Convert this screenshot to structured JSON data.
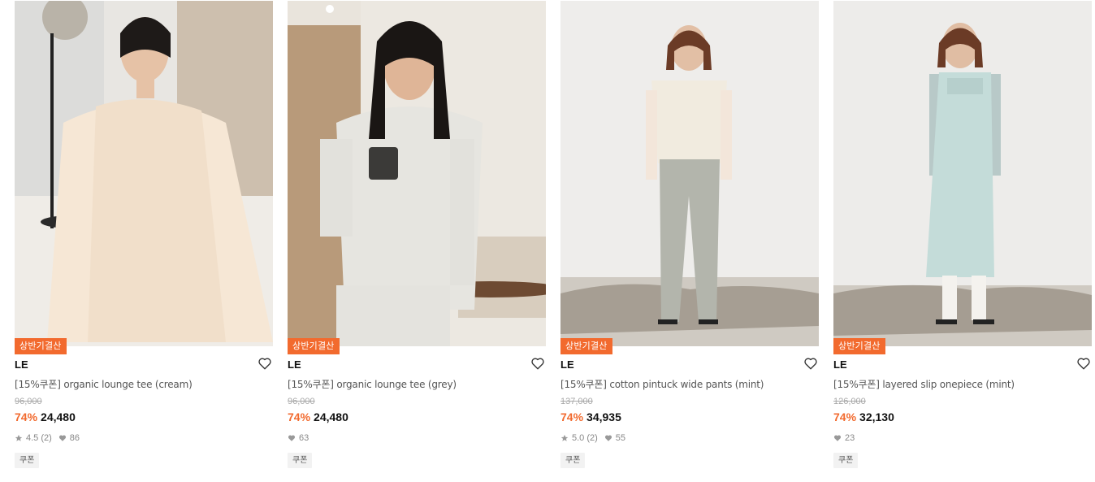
{
  "products": [
    {
      "promo_badge": "상반기결산",
      "brand": "LE",
      "title": "[15%쿠폰] organic lounge tee (cream)",
      "original_price": "96,000",
      "discount": "74%",
      "sale_price": "24,480",
      "rating": "4.5 (2)",
      "likes": "86",
      "coupon_label": "쿠폰",
      "image": "model in cream long-sleeve lounge tee sitting on sofa"
    },
    {
      "promo_badge": "상반기결산",
      "brand": "LE",
      "title": "[15%쿠폰] organic lounge tee (grey)",
      "original_price": "96,000",
      "discount": "74%",
      "sale_price": "24,480",
      "rating": "",
      "likes": "63",
      "coupon_label": "쿠폰",
      "image": "model in grey lounge tee holding mug"
    },
    {
      "promo_badge": "상반기결산",
      "brand": "LE",
      "title": "[15%쿠폰] cotton pintuck wide pants (mint)",
      "original_price": "137,000",
      "discount": "74%",
      "sale_price": "34,935",
      "rating": "5.0 (2)",
      "likes": "55",
      "coupon_label": "쿠폰",
      "image": "model in mint wide pants and cream knit vest"
    },
    {
      "promo_badge": "상반기결산",
      "brand": "LE",
      "title": "[15%쿠폰] layered slip onepiece (mint)",
      "original_price": "126,000",
      "discount": "74%",
      "sale_price": "32,130",
      "rating": "",
      "likes": "23",
      "coupon_label": "쿠폰",
      "image": "model in mint slip dress over shirt"
    }
  ],
  "colors": {
    "accent": "#f26a2e",
    "muted": "#a8a8a8",
    "coupon_bg": "#f2f2f2"
  }
}
